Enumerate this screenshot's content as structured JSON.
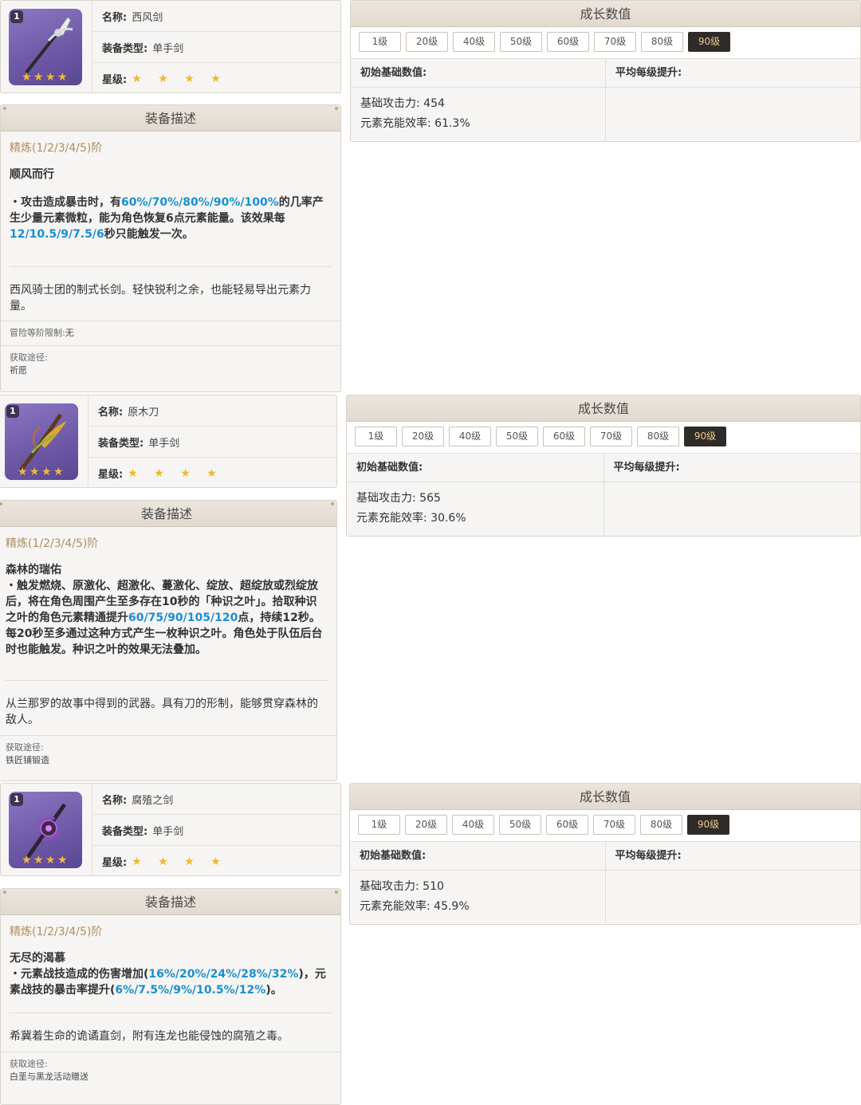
{
  "labels": {
    "name": "名称:",
    "type": "装备类型:",
    "rarity": "星级:",
    "growth_title": "成长数值",
    "base_stats": "初始基础数值:",
    "avg_growth": "平均每级提升:",
    "desc_title": "装备描述",
    "refine": "精炼(1/2/3/4/5)阶",
    "obtain": "获取途径:",
    "ascension": "冒险等阶限制:"
  },
  "levels": [
    "1级",
    "20级",
    "40级",
    "50级",
    "60级",
    "70级",
    "80级",
    "90级"
  ],
  "active_level": "90级",
  "weapons": [
    {
      "level_badge": "1",
      "name": "西风剑",
      "type": "单手剑",
      "stars": "★ ★ ★ ★",
      "rarity": 4,
      "stat1": "基础攻击力: 454",
      "stat2": "元素充能效率: 61.3%",
      "skill_name": "顺风而行",
      "effect_parts": [
        {
          "t": "・攻击造成暴击时，有",
          "h": false
        },
        {
          "t": "60%/70%/80%/90%/100%",
          "h": true
        },
        {
          "t": "的几率产生少量元素微粒，能为角色恢复6点元素能量。该效果每",
          "h": false
        },
        {
          "t": "12/10.5/9/7.5/6",
          "h": true
        },
        {
          "t": "秒只能触发一次。",
          "h": false
        }
      ],
      "lore": "西风骑士团的制式长剑。轻快锐利之余，也能轻易导出元素力量。",
      "ascension_value": "无",
      "obtain_value": "祈愿"
    },
    {
      "level_badge": "1",
      "name": "原木刀",
      "type": "单手剑",
      "stars": "★ ★ ★ ★",
      "rarity": 4,
      "stat1": "基础攻击力: 565",
      "stat2": "元素充能效率: 30.6%",
      "skill_name": "森林的瑞佑",
      "effect_parts": [
        {
          "t": "・触发燃烧、原激化、超激化、蔓激化、绽放、超绽放或烈绽放后，将在角色周围产生至多存在10秒的「种识之叶」。拾取种识之叶的角色元素精通提升",
          "h": false
        },
        {
          "t": "60/75/90/105/120",
          "h": true
        },
        {
          "t": "点，持续12秒。每20秒至多通过这种方式产生一枚种识之叶。角色处于队伍后台时也能触发。种识之叶的效果无法叠加。",
          "h": false
        }
      ],
      "lore": "从兰那罗的故事中得到的武器。具有刀的形制，能够贯穿森林的敌人。",
      "obtain_value": "铁匠铺锻造"
    },
    {
      "level_badge": "1",
      "name": "腐殖之剑",
      "type": "单手剑",
      "stars": "★ ★ ★ ★",
      "rarity": 4,
      "stat1": "基础攻击力: 510",
      "stat2": "元素充能效率: 45.9%",
      "skill_name": "无尽的渴慕",
      "effect_parts": [
        {
          "t": "・元素战技造成的伤害增加(",
          "h": false
        },
        {
          "t": "16%/20%/24%/28%/32%",
          "h": true
        },
        {
          "t": ")，元素战技的暴击率提升(",
          "h": false
        },
        {
          "t": "6%/7.5%/9%/10.5%/12%",
          "h": true
        },
        {
          "t": ")。",
          "h": false
        }
      ],
      "lore": "希冀着生命的诡谲直剑，附有连龙也能侵蚀的腐殖之毒。",
      "obtain_value": "白垩与黑龙活动赠送"
    }
  ]
}
